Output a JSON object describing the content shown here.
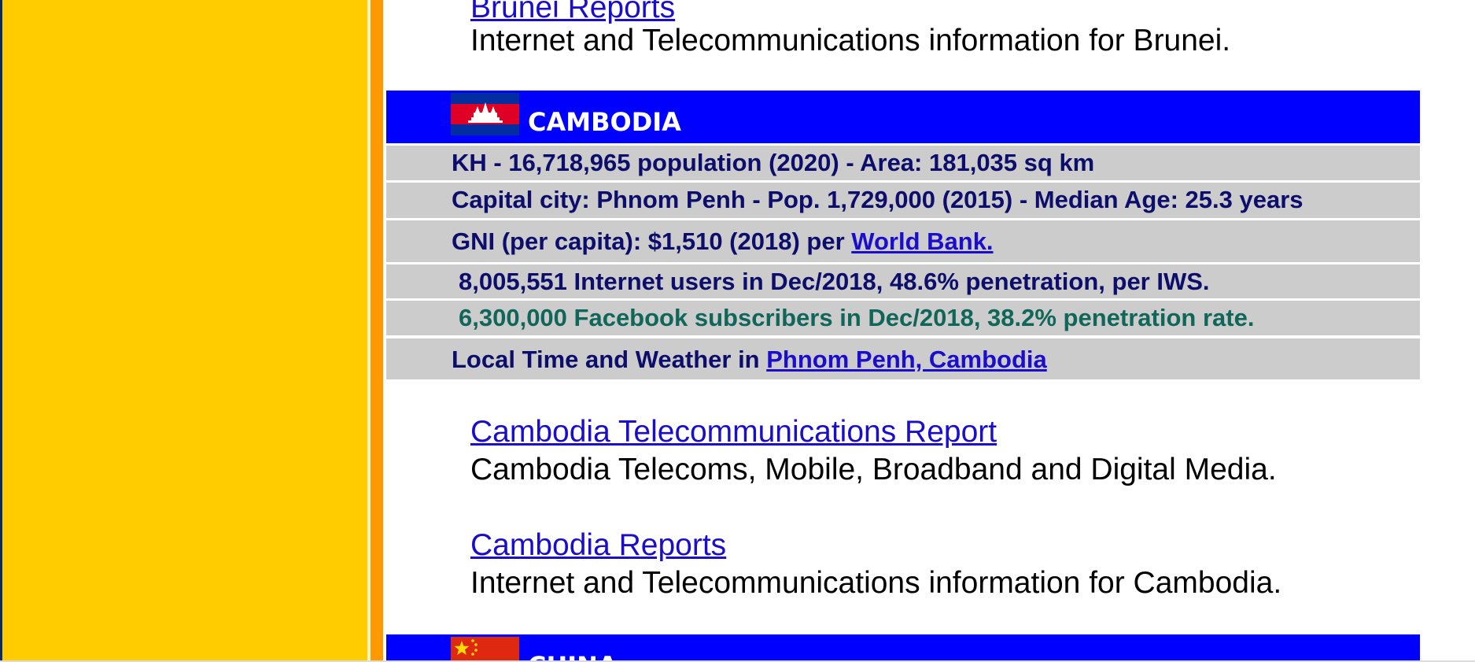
{
  "brunei": {
    "report_link": "Brunei Reports",
    "report_desc": "Internet and Telecommunications information for Brunei."
  },
  "cambodia": {
    "name": "CAMBODIA",
    "flag_icon": "cambodia-flag",
    "stats": {
      "population": "KH - 16,718,965 population (2020) - Area: 181,035 sq km",
      "capital": "Capital city: Phnom Penh - Pop. 1,729,000 (2015) - Median Age: 25.3 years",
      "gni_prefix": "GNI (per capita): $1,510 (2018) per ",
      "gni_link": "World Bank.",
      "internet_users": "8,005,551 Internet users in Dec/2018, 48.6% penetration, per IWS.",
      "facebook": "6,300,000 Facebook subscribers in Dec/2018, 38.2% penetration rate.",
      "time_prefix": "Local Time and Weather in ",
      "time_link": "Phnom Penh, Cambodia"
    },
    "telecom_report_link": "Cambodia Telecommunications Report",
    "telecom_report_desc": "Cambodia Telecoms, Mobile, Broadband and Digital Media.",
    "reports_link": "Cambodia Reports",
    "reports_desc": "Internet and Telecommunications information for Cambodia."
  },
  "china": {
    "name": "CHINA",
    "flag_icon": "china-flag"
  },
  "colors": {
    "sidebar": "#ffcc00",
    "sidebar_stripe": "#ff9900",
    "header_bg": "#0000ff",
    "row_bg": "#cccccc",
    "row_text": "#0d0d6b",
    "facebook_text": "#11665a",
    "link": "#1a0dcc"
  }
}
